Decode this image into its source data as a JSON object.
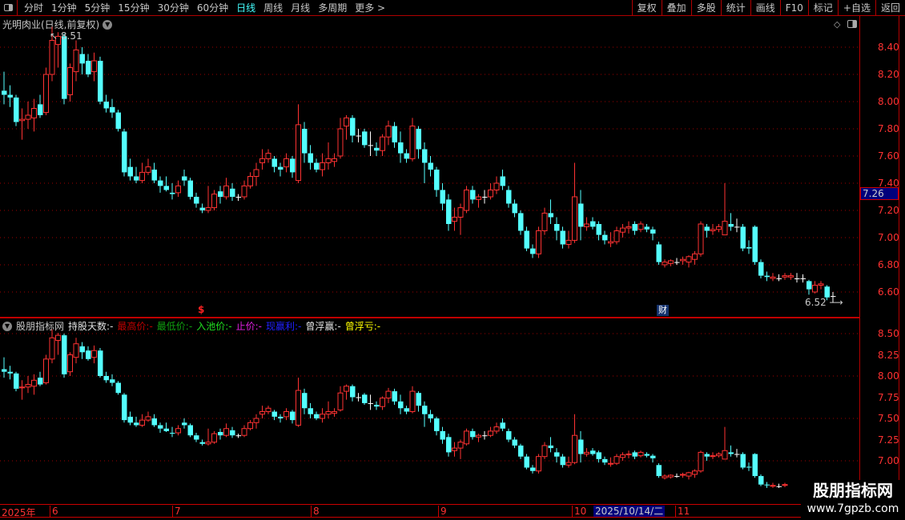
{
  "toolbar": {
    "periods": [
      "分时",
      "1分钟",
      "5分钟",
      "15分钟",
      "30分钟",
      "60分钟",
      "日线",
      "周线",
      "月线",
      "多周期",
      "更多 >"
    ],
    "active_period": "日线",
    "buttons": [
      "复权",
      "叠加",
      "多股",
      "统计",
      "画线",
      "F10",
      "标记",
      "+自选",
      "返回"
    ]
  },
  "main_chart": {
    "title": "光明肉业(日线,前复权)",
    "high_label": "8.51",
    "low_label": "6.52",
    "current_price": "7.26",
    "y_ticks": [
      "8.40",
      "8.20",
      "8.00",
      "7.80",
      "7.60",
      "7.40",
      "7.20",
      "7.00",
      "6.80",
      "6.60"
    ],
    "cai_badge": "财",
    "dollar_marker": "$"
  },
  "indicator": {
    "name": "股朋指标网",
    "fields": [
      {
        "label": "持股天数:",
        "value": "-",
        "color": "#e0e0e0"
      },
      {
        "label": "最高价:",
        "value": "-",
        "color": "#c00000"
      },
      {
        "label": "最低价:",
        "value": "-",
        "color": "#10a010"
      },
      {
        "label": "入池价:",
        "value": "-",
        "color": "#20e020"
      },
      {
        "label": "止价:",
        "value": "-",
        "color": "#e020e0"
      },
      {
        "label": "现赢利:",
        "value": "-",
        "color": "#2020ff"
      },
      {
        "label": "曾浮赢:",
        "value": "-",
        "color": "#e0e0e0"
      },
      {
        "label": "曾浮亏:",
        "value": "-",
        "color": "#ffff00"
      }
    ],
    "y_ticks": [
      "8.50",
      "8.25",
      "8.00",
      "7.75",
      "7.50",
      "7.25",
      "7.00"
    ]
  },
  "date_axis": {
    "labels": [
      "2025年",
      "6",
      "7",
      "8",
      "9",
      "10",
      "11"
    ],
    "cursor_date": "2025/10/14/二"
  },
  "logo": {
    "name": "股朋指标网",
    "url": "www.7gpzb.com"
  },
  "colors": {
    "up": "#ff3232",
    "down": "#54ffff",
    "doji": "#ffffff",
    "grid": "#b00000"
  },
  "chart_data": {
    "type": "candlestick",
    "fields": [
      "open",
      "high",
      "low",
      "close"
    ],
    "candles": [
      [
        8.08,
        8.22,
        7.98,
        8.05
      ],
      [
        8.05,
        8.12,
        7.96,
        8.03
      ],
      [
        8.03,
        8.05,
        7.82,
        7.85
      ],
      [
        7.86,
        7.95,
        7.72,
        7.87
      ],
      [
        7.87,
        8.0,
        7.8,
        7.9
      ],
      [
        7.88,
        8.02,
        7.78,
        7.95
      ],
      [
        7.98,
        8.05,
        7.88,
        7.9
      ],
      [
        7.92,
        8.25,
        7.9,
        8.2
      ],
      [
        8.2,
        8.55,
        8.15,
        8.45
      ],
      [
        8.42,
        8.51,
        8.25,
        8.48
      ],
      [
        8.48,
        8.5,
        7.98,
        8.02
      ],
      [
        8.05,
        8.28,
        8.0,
        8.25
      ],
      [
        8.22,
        8.45,
        8.15,
        8.38
      ],
      [
        8.35,
        8.4,
        8.2,
        8.28
      ],
      [
        8.3,
        8.35,
        8.18,
        8.2
      ],
      [
        8.22,
        8.36,
        8.15,
        8.3
      ],
      [
        8.3,
        8.33,
        7.98,
        8.0
      ],
      [
        8.0,
        8.05,
        7.92,
        7.95
      ],
      [
        7.96,
        8.02,
        7.88,
        7.92
      ],
      [
        7.92,
        7.94,
        7.78,
        7.8
      ],
      [
        7.78,
        7.8,
        7.45,
        7.48
      ],
      [
        7.52,
        7.58,
        7.42,
        7.45
      ],
      [
        7.45,
        7.52,
        7.4,
        7.42
      ],
      [
        7.42,
        7.55,
        7.4,
        7.48
      ],
      [
        7.48,
        7.58,
        7.46,
        7.52
      ],
      [
        7.5,
        7.55,
        7.4,
        7.42
      ],
      [
        7.42,
        7.45,
        7.33,
        7.38
      ],
      [
        7.38,
        7.45,
        7.34,
        7.35
      ],
      [
        7.33,
        7.4,
        7.28,
        7.32
      ],
      [
        7.33,
        7.42,
        7.3,
        7.38
      ],
      [
        7.45,
        7.5,
        7.38,
        7.42
      ],
      [
        7.42,
        7.44,
        7.28,
        7.3
      ],
      [
        7.3,
        7.33,
        7.22,
        7.25
      ],
      [
        7.22,
        7.25,
        7.18,
        7.2
      ],
      [
        7.2,
        7.38,
        7.18,
        7.22
      ],
      [
        7.22,
        7.35,
        7.2,
        7.32
      ],
      [
        7.34,
        7.38,
        7.25,
        7.3
      ],
      [
        7.3,
        7.44,
        7.28,
        7.38
      ],
      [
        7.36,
        7.4,
        7.27,
        7.3
      ],
      [
        7.3,
        7.32,
        7.27,
        7.3
      ],
      [
        7.3,
        7.42,
        7.28,
        7.38
      ],
      [
        7.38,
        7.48,
        7.36,
        7.45
      ],
      [
        7.45,
        7.55,
        7.38,
        7.5
      ],
      [
        7.55,
        7.65,
        7.5,
        7.58
      ],
      [
        7.58,
        7.65,
        7.55,
        7.62
      ],
      [
        7.58,
        7.6,
        7.48,
        7.52
      ],
      [
        7.52,
        7.55,
        7.45,
        7.5
      ],
      [
        7.52,
        7.62,
        7.48,
        7.58
      ],
      [
        7.58,
        7.6,
        7.44,
        7.48
      ],
      [
        7.42,
        7.98,
        7.4,
        7.83
      ],
      [
        7.8,
        7.85,
        7.55,
        7.62
      ],
      [
        7.62,
        7.68,
        7.5,
        7.55
      ],
      [
        7.55,
        7.58,
        7.48,
        7.5
      ],
      [
        7.5,
        7.62,
        7.45,
        7.55
      ],
      [
        7.55,
        7.7,
        7.5,
        7.58
      ],
      [
        7.56,
        7.62,
        7.52,
        7.58
      ],
      [
        7.6,
        7.88,
        7.58,
        7.8
      ],
      [
        7.82,
        7.9,
        7.72,
        7.88
      ],
      [
        7.88,
        7.9,
        7.7,
        7.75
      ],
      [
        7.75,
        7.8,
        7.7,
        7.75
      ],
      [
        7.78,
        7.8,
        7.66,
        7.68
      ],
      [
        7.68,
        7.78,
        7.6,
        7.68
      ],
      [
        7.66,
        7.7,
        7.6,
        7.64
      ],
      [
        7.64,
        7.76,
        7.6,
        7.74
      ],
      [
        7.74,
        7.86,
        7.68,
        7.82
      ],
      [
        7.82,
        7.85,
        7.66,
        7.7
      ],
      [
        7.7,
        7.78,
        7.55,
        7.62
      ],
      [
        7.62,
        7.65,
        7.55,
        7.58
      ],
      [
        7.58,
        7.88,
        7.56,
        7.82
      ],
      [
        7.8,
        7.82,
        7.58,
        7.65
      ],
      [
        7.65,
        7.7,
        7.4,
        7.55
      ],
      [
        7.55,
        7.6,
        7.45,
        7.5
      ],
      [
        7.5,
        7.52,
        7.3,
        7.35
      ],
      [
        7.35,
        7.4,
        7.2,
        7.25
      ],
      [
        7.28,
        7.32,
        7.05,
        7.1
      ],
      [
        7.12,
        7.22,
        7.05,
        7.15
      ],
      [
        7.15,
        7.25,
        7.02,
        7.22
      ],
      [
        7.2,
        7.38,
        7.18,
        7.35
      ],
      [
        7.35,
        7.38,
        7.25,
        7.28
      ],
      [
        7.28,
        7.32,
        7.22,
        7.3
      ],
      [
        7.3,
        7.35,
        7.25,
        7.3
      ],
      [
        7.3,
        7.4,
        7.28,
        7.35
      ],
      [
        7.35,
        7.45,
        7.32,
        7.4
      ],
      [
        7.45,
        7.5,
        7.35,
        7.38
      ],
      [
        7.35,
        7.38,
        7.22,
        7.25
      ],
      [
        7.25,
        7.28,
        7.15,
        7.18
      ],
      [
        7.18,
        7.2,
        7.02,
        7.05
      ],
      [
        7.05,
        7.08,
        6.9,
        6.92
      ],
      [
        6.92,
        6.95,
        6.85,
        6.88
      ],
      [
        6.88,
        7.08,
        6.85,
        7.05
      ],
      [
        7.05,
        7.22,
        7.02,
        7.18
      ],
      [
        7.18,
        7.28,
        7.1,
        7.15
      ],
      [
        7.1,
        7.15,
        6.98,
        7.05
      ],
      [
        7.05,
        7.08,
        6.92,
        6.95
      ],
      [
        6.95,
        7.05,
        6.92,
        6.98
      ],
      [
        6.98,
        7.55,
        6.96,
        7.3
      ],
      [
        7.25,
        7.35,
        6.98,
        7.08
      ],
      [
        7.08,
        7.15,
        7.05,
        7.1
      ],
      [
        7.12,
        7.15,
        7.06,
        7.08
      ],
      [
        7.1,
        7.12,
        6.98,
        7.02
      ],
      [
        7.02,
        7.05,
        6.95,
        6.98
      ],
      [
        6.96,
        7.04,
        6.93,
        6.97
      ],
      [
        6.97,
        7.08,
        6.95,
        7.05
      ],
      [
        7.04,
        7.1,
        7.0,
        7.07
      ],
      [
        7.07,
        7.12,
        7.03,
        7.08
      ],
      [
        7.1,
        7.12,
        7.02,
        7.05
      ],
      [
        7.06,
        7.12,
        7.04,
        7.1
      ],
      [
        7.08,
        7.1,
        7.04,
        7.06
      ],
      [
        7.06,
        7.08,
        6.98,
        7.03
      ],
      [
        6.95,
        6.97,
        6.8,
        6.82
      ],
      [
        6.8,
        6.84,
        6.78,
        6.82
      ],
      [
        6.81,
        6.84,
        6.79,
        6.83
      ],
      [
        6.82,
        6.85,
        6.8,
        6.82
      ],
      [
        6.83,
        6.86,
        6.8,
        6.84
      ],
      [
        6.82,
        6.87,
        6.78,
        6.86
      ],
      [
        6.84,
        6.9,
        6.8,
        6.88
      ],
      [
        6.88,
        7.12,
        6.86,
        7.1
      ],
      [
        7.08,
        7.1,
        7.0,
        7.05
      ],
      [
        7.05,
        7.1,
        7.02,
        7.06
      ],
      [
        7.06,
        7.1,
        7.04,
        7.08
      ],
      [
        7.02,
        7.4,
        7.02,
        7.12
      ],
      [
        7.1,
        7.18,
        7.05,
        7.08
      ],
      [
        7.08,
        7.14,
        7.04,
        7.08
      ],
      [
        7.08,
        7.1,
        6.9,
        6.92
      ],
      [
        6.93,
        6.98,
        6.88,
        6.92
      ],
      [
        7.08,
        7.09,
        6.8,
        6.82
      ],
      [
        6.82,
        6.84,
        6.7,
        6.72
      ],
      [
        6.72,
        6.75,
        6.68,
        6.71
      ],
      [
        6.7,
        6.74,
        6.68,
        6.71
      ],
      [
        6.7,
        6.73,
        6.68,
        6.7
      ],
      [
        6.71,
        6.74,
        6.69,
        6.72
      ],
      [
        6.71,
        6.74,
        6.69,
        6.72
      ],
      [
        6.7,
        6.74,
        6.67,
        6.7
      ],
      [
        6.7,
        6.73,
        6.67,
        6.7
      ],
      [
        6.68,
        6.69,
        6.58,
        6.62
      ],
      [
        6.6,
        6.68,
        6.59,
        6.65
      ],
      [
        6.65,
        6.68,
        6.62,
        6.66
      ],
      [
        6.64,
        6.65,
        6.54,
        6.56
      ],
      [
        6.57,
        6.6,
        6.52,
        6.57
      ]
    ]
  }
}
